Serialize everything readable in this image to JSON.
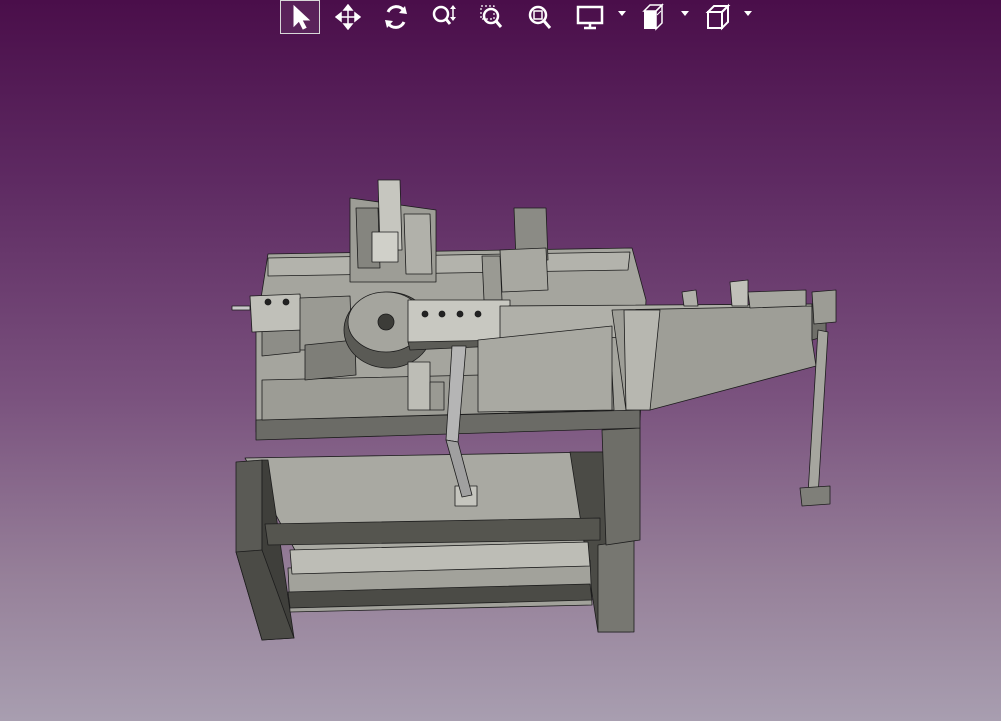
{
  "viewer": {
    "background_top": "#4a0e4a",
    "background_bottom": "#a89eb0"
  },
  "toolbar": {
    "tools": [
      {
        "id": "select",
        "icon": "select-cursor-icon",
        "active": true
      },
      {
        "id": "pan",
        "icon": "pan-move-icon",
        "active": false
      },
      {
        "id": "rotate",
        "icon": "rotate-orbit-icon",
        "active": false
      },
      {
        "id": "zoom",
        "icon": "zoom-updown-icon",
        "active": false
      },
      {
        "id": "zoom-window",
        "icon": "zoom-window-icon",
        "active": false
      },
      {
        "id": "zoom-fit",
        "icon": "zoom-fit-icon",
        "active": false
      },
      {
        "id": "display",
        "icon": "display-monitor-icon",
        "dropdown": true
      },
      {
        "id": "views",
        "icon": "standard-views-icon",
        "dropdown": true
      },
      {
        "id": "projection",
        "icon": "projection-cube-icon",
        "dropdown": true
      }
    ]
  },
  "model": {
    "name": "machine-assembly-3d",
    "surface_color": "#a9a9a2",
    "shadow_color": "#4b4b46",
    "edge_color": "#1c1c1c"
  }
}
